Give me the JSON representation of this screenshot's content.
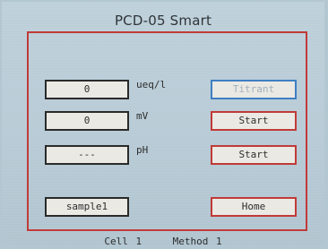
{
  "header": {
    "title": "PCD-05 Smart"
  },
  "readings": [
    {
      "value": "0",
      "unit": "ueq/l"
    },
    {
      "value": "0",
      "unit": "mV"
    },
    {
      "value": "---",
      "unit": "pH"
    }
  ],
  "sample": {
    "name": "sample1"
  },
  "buttons": {
    "titrant": {
      "label": "Titrant",
      "enabled": false
    },
    "start_mv": {
      "label": "Start"
    },
    "start_ph": {
      "label": "Start"
    },
    "home": {
      "label": "Home"
    }
  },
  "status": {
    "cell": "Cell 1",
    "method": "Method 1"
  },
  "colors": {
    "background": "#b8cbd6",
    "frame_border": "#c03a38",
    "button_border": "#c03a38",
    "disabled_border": "#3f7fc4",
    "disabled_text": "#9fb1bd",
    "field_border": "#2a2a2a",
    "field_fill": "#ebe9e3"
  }
}
